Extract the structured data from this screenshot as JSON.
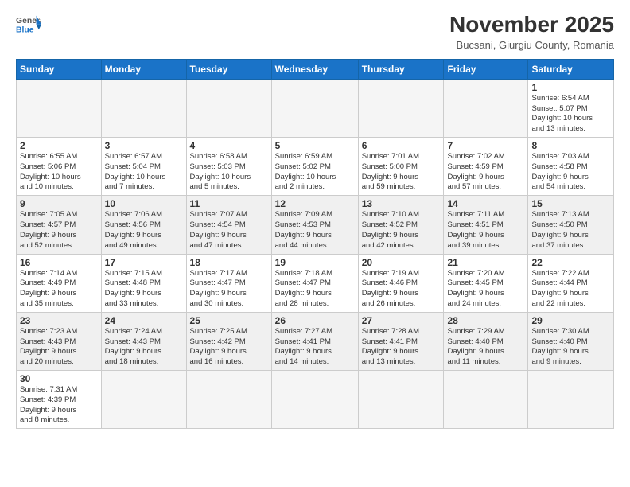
{
  "logo": {
    "general": "General",
    "blue": "Blue"
  },
  "title": {
    "month_year": "November 2025",
    "location": "Bucsani, Giurgiu County, Romania"
  },
  "weekdays": [
    "Sunday",
    "Monday",
    "Tuesday",
    "Wednesday",
    "Thursday",
    "Friday",
    "Saturday"
  ],
  "weeks": [
    {
      "shaded": false,
      "days": [
        {
          "num": "",
          "info": ""
        },
        {
          "num": "",
          "info": ""
        },
        {
          "num": "",
          "info": ""
        },
        {
          "num": "",
          "info": ""
        },
        {
          "num": "",
          "info": ""
        },
        {
          "num": "",
          "info": ""
        },
        {
          "num": "1",
          "info": "Sunrise: 6:54 AM\nSunset: 5:07 PM\nDaylight: 10 hours\nand 13 minutes."
        }
      ]
    },
    {
      "shaded": false,
      "days": [
        {
          "num": "2",
          "info": "Sunrise: 6:55 AM\nSunset: 5:06 PM\nDaylight: 10 hours\nand 10 minutes."
        },
        {
          "num": "3",
          "info": "Sunrise: 6:57 AM\nSunset: 5:04 PM\nDaylight: 10 hours\nand 7 minutes."
        },
        {
          "num": "4",
          "info": "Sunrise: 6:58 AM\nSunset: 5:03 PM\nDaylight: 10 hours\nand 5 minutes."
        },
        {
          "num": "5",
          "info": "Sunrise: 6:59 AM\nSunset: 5:02 PM\nDaylight: 10 hours\nand 2 minutes."
        },
        {
          "num": "6",
          "info": "Sunrise: 7:01 AM\nSunset: 5:00 PM\nDaylight: 9 hours\nand 59 minutes."
        },
        {
          "num": "7",
          "info": "Sunrise: 7:02 AM\nSunset: 4:59 PM\nDaylight: 9 hours\nand 57 minutes."
        },
        {
          "num": "8",
          "info": "Sunrise: 7:03 AM\nSunset: 4:58 PM\nDaylight: 9 hours\nand 54 minutes."
        }
      ]
    },
    {
      "shaded": true,
      "days": [
        {
          "num": "9",
          "info": "Sunrise: 7:05 AM\nSunset: 4:57 PM\nDaylight: 9 hours\nand 52 minutes."
        },
        {
          "num": "10",
          "info": "Sunrise: 7:06 AM\nSunset: 4:56 PM\nDaylight: 9 hours\nand 49 minutes."
        },
        {
          "num": "11",
          "info": "Sunrise: 7:07 AM\nSunset: 4:54 PM\nDaylight: 9 hours\nand 47 minutes."
        },
        {
          "num": "12",
          "info": "Sunrise: 7:09 AM\nSunset: 4:53 PM\nDaylight: 9 hours\nand 44 minutes."
        },
        {
          "num": "13",
          "info": "Sunrise: 7:10 AM\nSunset: 4:52 PM\nDaylight: 9 hours\nand 42 minutes."
        },
        {
          "num": "14",
          "info": "Sunrise: 7:11 AM\nSunset: 4:51 PM\nDaylight: 9 hours\nand 39 minutes."
        },
        {
          "num": "15",
          "info": "Sunrise: 7:13 AM\nSunset: 4:50 PM\nDaylight: 9 hours\nand 37 minutes."
        }
      ]
    },
    {
      "shaded": false,
      "days": [
        {
          "num": "16",
          "info": "Sunrise: 7:14 AM\nSunset: 4:49 PM\nDaylight: 9 hours\nand 35 minutes."
        },
        {
          "num": "17",
          "info": "Sunrise: 7:15 AM\nSunset: 4:48 PM\nDaylight: 9 hours\nand 33 minutes."
        },
        {
          "num": "18",
          "info": "Sunrise: 7:17 AM\nSunset: 4:47 PM\nDaylight: 9 hours\nand 30 minutes."
        },
        {
          "num": "19",
          "info": "Sunrise: 7:18 AM\nSunset: 4:47 PM\nDaylight: 9 hours\nand 28 minutes."
        },
        {
          "num": "20",
          "info": "Sunrise: 7:19 AM\nSunset: 4:46 PM\nDaylight: 9 hours\nand 26 minutes."
        },
        {
          "num": "21",
          "info": "Sunrise: 7:20 AM\nSunset: 4:45 PM\nDaylight: 9 hours\nand 24 minutes."
        },
        {
          "num": "22",
          "info": "Sunrise: 7:22 AM\nSunset: 4:44 PM\nDaylight: 9 hours\nand 22 minutes."
        }
      ]
    },
    {
      "shaded": true,
      "days": [
        {
          "num": "23",
          "info": "Sunrise: 7:23 AM\nSunset: 4:43 PM\nDaylight: 9 hours\nand 20 minutes."
        },
        {
          "num": "24",
          "info": "Sunrise: 7:24 AM\nSunset: 4:43 PM\nDaylight: 9 hours\nand 18 minutes."
        },
        {
          "num": "25",
          "info": "Sunrise: 7:25 AM\nSunset: 4:42 PM\nDaylight: 9 hours\nand 16 minutes."
        },
        {
          "num": "26",
          "info": "Sunrise: 7:27 AM\nSunset: 4:41 PM\nDaylight: 9 hours\nand 14 minutes."
        },
        {
          "num": "27",
          "info": "Sunrise: 7:28 AM\nSunset: 4:41 PM\nDaylight: 9 hours\nand 13 minutes."
        },
        {
          "num": "28",
          "info": "Sunrise: 7:29 AM\nSunset: 4:40 PM\nDaylight: 9 hours\nand 11 minutes."
        },
        {
          "num": "29",
          "info": "Sunrise: 7:30 AM\nSunset: 4:40 PM\nDaylight: 9 hours\nand 9 minutes."
        }
      ]
    },
    {
      "shaded": false,
      "days": [
        {
          "num": "30",
          "info": "Sunrise: 7:31 AM\nSunset: 4:39 PM\nDaylight: 9 hours\nand 8 minutes."
        },
        {
          "num": "",
          "info": ""
        },
        {
          "num": "",
          "info": ""
        },
        {
          "num": "",
          "info": ""
        },
        {
          "num": "",
          "info": ""
        },
        {
          "num": "",
          "info": ""
        },
        {
          "num": "",
          "info": ""
        }
      ]
    }
  ]
}
